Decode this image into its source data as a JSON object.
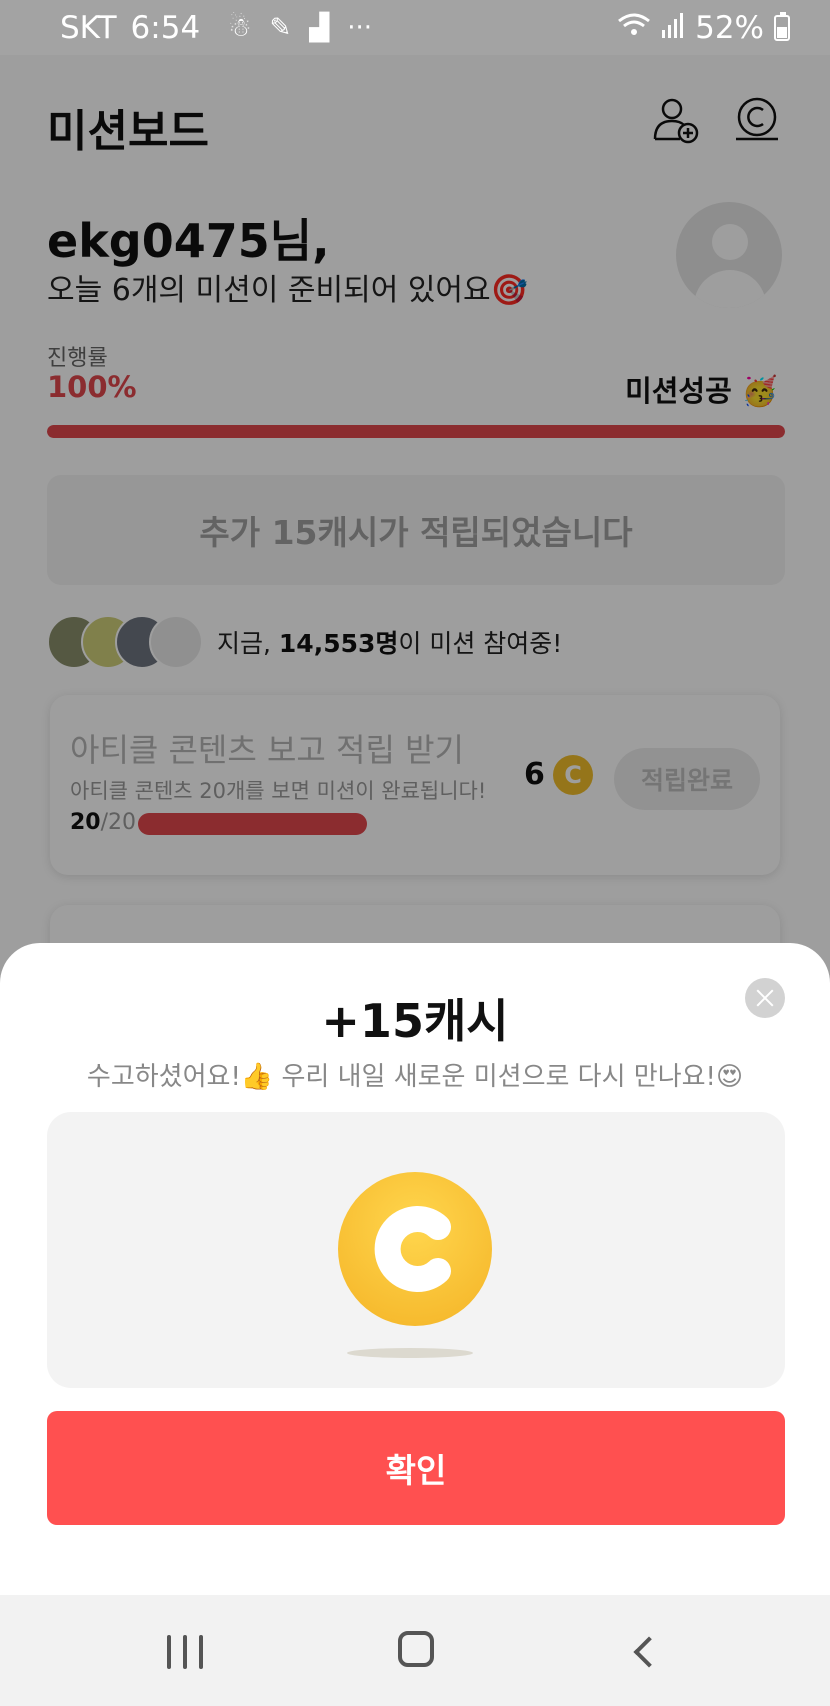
{
  "status_bar": {
    "carrier": "SKT",
    "time": "6:54",
    "notification_icons": [
      "app-notification-icon",
      "pen-icon",
      "stairs-icon"
    ],
    "more": "···",
    "battery": "52%",
    "colors": {
      "background": "#a3a3a3"
    }
  },
  "header": {
    "title": "미션보드",
    "icons": [
      "add-friend-icon",
      "cash-coin-icon"
    ]
  },
  "greeting": {
    "name": "ekg0475님,",
    "message": "오늘 6개의 미션이 준비되어 있어요🎯"
  },
  "progress": {
    "label": "진행률",
    "value": "100%",
    "fraction": 1.0,
    "status": "미션성공 🥳"
  },
  "extra_cash": {
    "text": "추가 15캐시가 적립되었습니다"
  },
  "participants": {
    "prefix": "지금, ",
    "count": "14,553명",
    "suffix": "이 미션 참여중!"
  },
  "mission": {
    "title": "아티클 콘텐츠 보고 적립 받기",
    "description": "아티클 콘텐츠 20개를 보면 미션이 완료됩니다!",
    "progress_done": "20",
    "progress_total": "/20",
    "progress_fraction": 1.0,
    "reward": "6",
    "button": "적립완료"
  },
  "sheet": {
    "title": "+15캐시",
    "subtitle": "수고하셨어요!👍 우리 내일 새로운 미션으로 다시 만나요!😍",
    "confirm": "확인"
  },
  "colors": {
    "accent": "#e0474c",
    "confirm_button": "#ff5050",
    "coin": "#f4b326"
  }
}
